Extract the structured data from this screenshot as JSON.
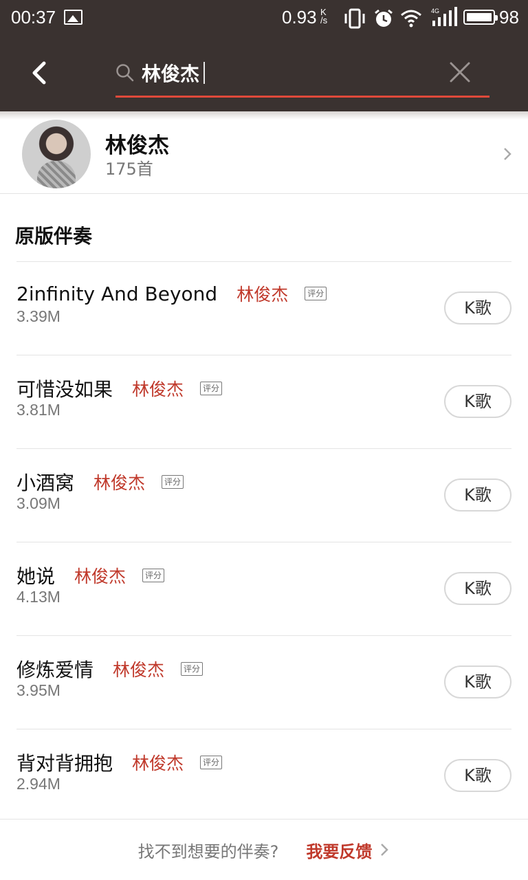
{
  "status_bar": {
    "time": "00:37",
    "net_speed": "0.93",
    "net_unit_top": "K",
    "net_unit_bottom": "/s",
    "network_type": "4G",
    "battery": "98"
  },
  "search": {
    "query": "林俊杰",
    "accent_color": "#e0493a"
  },
  "artist": {
    "name": "林俊杰",
    "count": "175首"
  },
  "section": {
    "title": "原版伴奏"
  },
  "songs": [
    {
      "title": "2infinity And Beyond",
      "artist": "林俊杰",
      "tag": "评分",
      "size": "3.39M",
      "action": "K歌"
    },
    {
      "title": "可惜没如果",
      "artist": "林俊杰",
      "tag": "评分",
      "size": "3.81M",
      "action": "K歌"
    },
    {
      "title": "小酒窝",
      "artist": "林俊杰",
      "tag": "评分",
      "size": "3.09M",
      "action": "K歌"
    },
    {
      "title": "她说",
      "artist": "林俊杰",
      "tag": "评分",
      "size": "4.13M",
      "action": "K歌"
    },
    {
      "title": "修炼爱情",
      "artist": "林俊杰",
      "tag": "评分",
      "size": "3.95M",
      "action": "K歌"
    },
    {
      "title": "背对背拥抱",
      "artist": "林俊杰",
      "tag": "评分",
      "size": "2.94M",
      "action": "K歌"
    }
  ],
  "footer": {
    "question": "找不到想要的伴奏?",
    "link": "我要反馈"
  },
  "colors": {
    "header_bg": "#3a3230",
    "artist_red": "#c0392b"
  }
}
